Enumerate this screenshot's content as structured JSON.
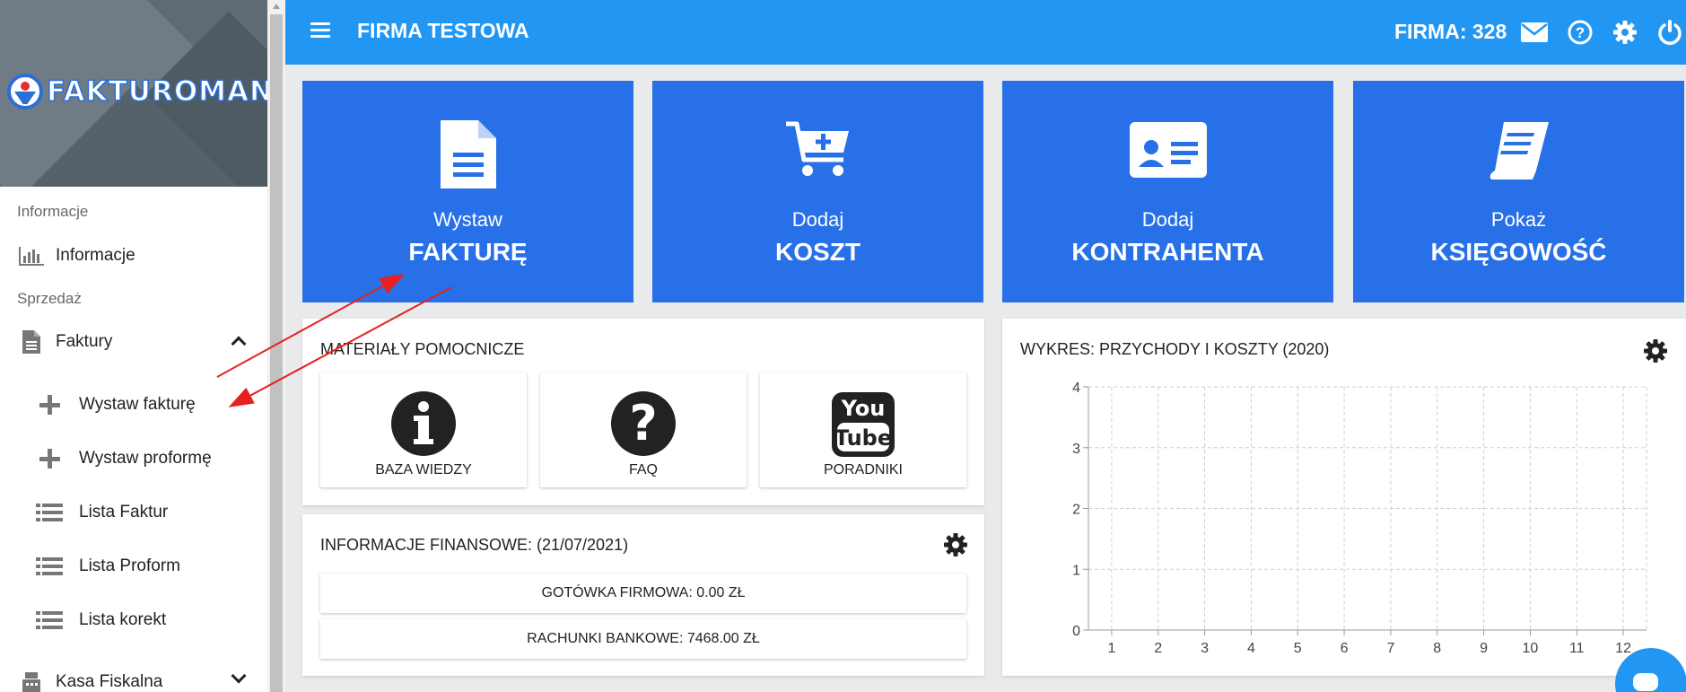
{
  "sidebar": {
    "logo_text": "FAKTUROMANIA",
    "section_info": "Informacje",
    "item_info": "Informacje",
    "section_sales": "Sprzedaż",
    "item_invoices": "Faktury",
    "sub_items": [
      "Wystaw fakturę",
      "Wystaw proformę",
      "Lista Faktur",
      "Lista Proform",
      "Lista korekt"
    ],
    "item_cash_register": "Kasa Fiskalna"
  },
  "topbar": {
    "title": "FIRMA TESTOWA",
    "firma_label": "FIRMA: 328",
    "icons": [
      "mail-icon",
      "help-icon",
      "gear-icon",
      "power-icon"
    ]
  },
  "tiles": [
    {
      "small": "Wystaw",
      "big": "FAKTURĘ",
      "icon": "document-icon"
    },
    {
      "small": "Dodaj",
      "big": "KOSZT",
      "icon": "cart-add-icon"
    },
    {
      "small": "Dodaj",
      "big": "KONTRAHENTA",
      "icon": "id-card-icon"
    },
    {
      "small": "Pokaż",
      "big": "KSIĘGOWOŚĆ",
      "icon": "book-icon"
    }
  ],
  "help_card": {
    "title": "MATERIAŁY POMOCNICZE",
    "items": [
      "BAZA WIEDZY",
      "FAQ",
      "PORADNIKI"
    ],
    "youtube_text_1": "You",
    "youtube_text_2": "Tube"
  },
  "finance_card": {
    "title": "INFORMACJE FINANSOWE: (21/07/2021)",
    "cash": "GOTÓWKA FIRMOWA: 0.00 ZŁ",
    "bank": "RACHUNKI BANKOWE: 7468.00 ZŁ"
  },
  "chart_card": {
    "title": "WYKRES: PRZYCHODY I KOSZTY (2020)"
  },
  "chart_data": {
    "type": "line",
    "title": "WYKRES: PRZYCHODY I KOSZTY (2020)",
    "x": [
      1,
      2,
      3,
      4,
      5,
      6,
      7,
      8,
      9,
      10,
      11,
      12
    ],
    "xticks": [
      "1",
      "2",
      "3",
      "4",
      "5",
      "6",
      "7",
      "8",
      "9",
      "10",
      "11",
      "12"
    ],
    "yticks": [
      "0",
      "1",
      "2",
      "3",
      "4"
    ],
    "ylim": [
      0,
      4
    ],
    "series": [],
    "grid": true
  },
  "colors": {
    "topbar": "#2196f3",
    "tile": "#2770e8",
    "annotation_arrow": "#e82020"
  }
}
